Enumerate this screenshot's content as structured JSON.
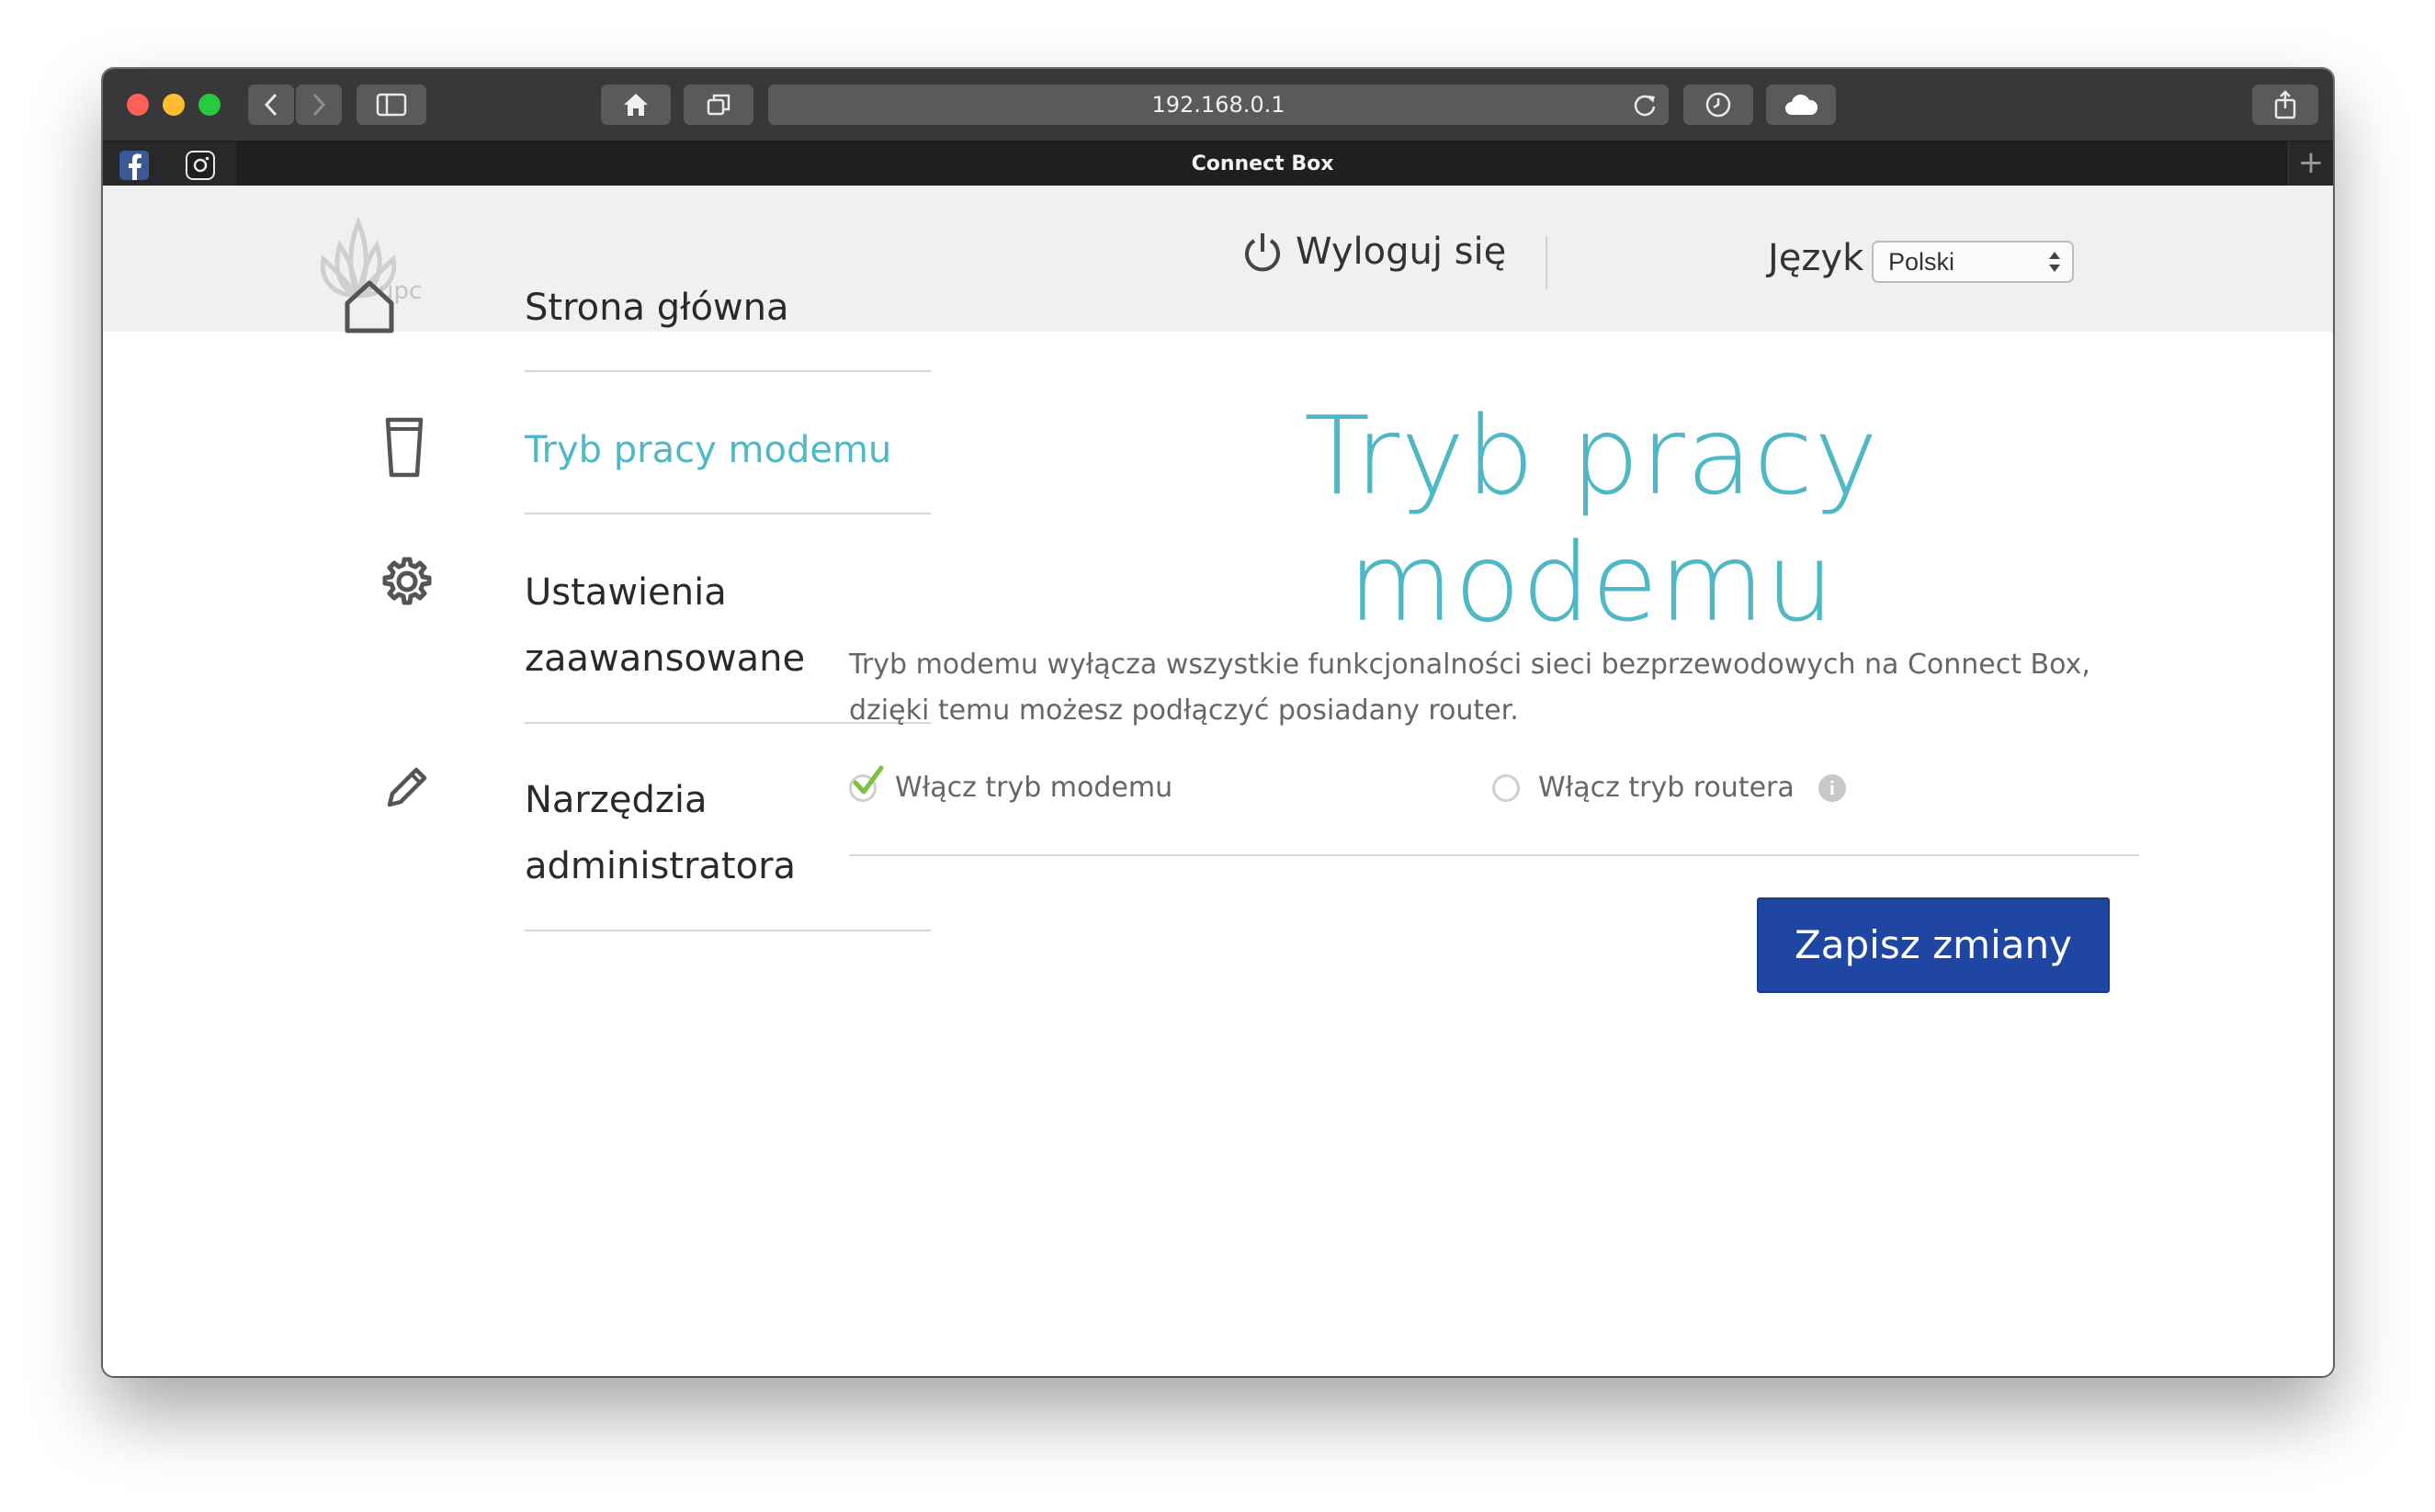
{
  "browser": {
    "url": "192.168.0.1",
    "tab_title": "Connect Box",
    "new_tab_label": "+"
  },
  "header": {
    "logo_text": "upc",
    "logout_label": "Wyloguj się",
    "language_label": "Język",
    "language_value": "Polski"
  },
  "sidebar": {
    "items": [
      {
        "label": "Strona główna",
        "active": false
      },
      {
        "label": "Tryb pracy modemu",
        "active": true
      },
      {
        "label": "Ustawienia zaawansowane",
        "active": false
      },
      {
        "label": "Narzędzia administratora",
        "active": false
      }
    ]
  },
  "main": {
    "title": "Tryb pracy modemu",
    "description": "Tryb modemu wyłącza wszystkie funkcjonalności sieci bezprzewodowych na Connect Box, dzięki temu możesz podłączyć posiadany router.",
    "option_modem": "Włącz tryb modemu",
    "option_router": "Włącz tryb routera",
    "selected": "modem",
    "save_label": "Zapisz zmiany"
  },
  "colors": {
    "accent": "#4fb8c6",
    "button": "#2046a4",
    "check": "#7cc142"
  }
}
